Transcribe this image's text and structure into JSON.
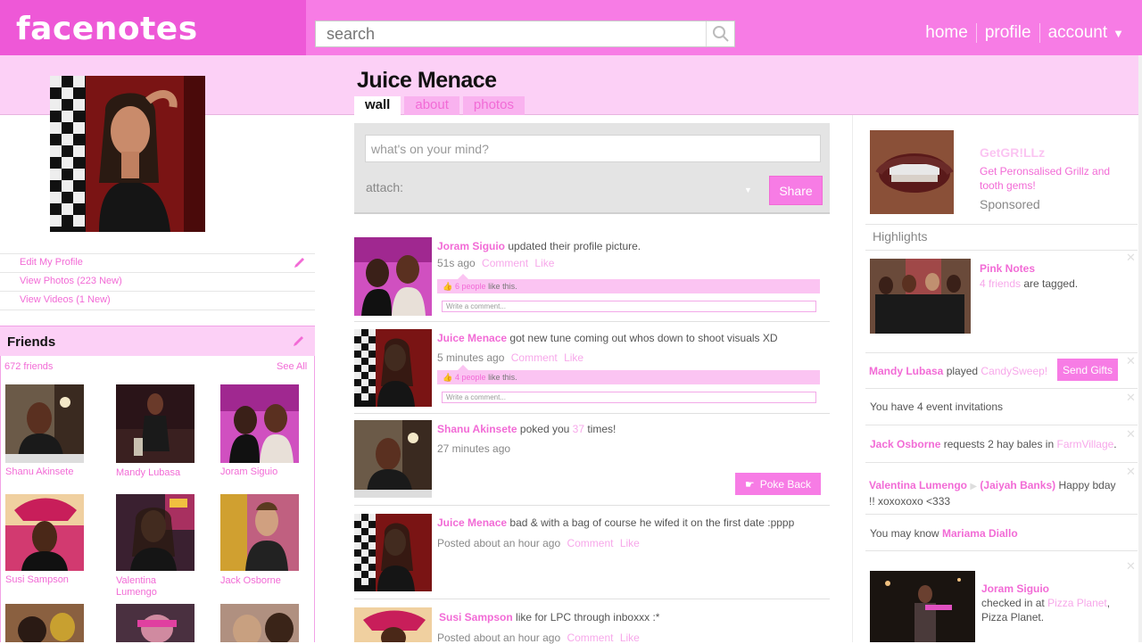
{
  "app": {
    "logo": "facenotes"
  },
  "search": {
    "placeholder": "search"
  },
  "nav": {
    "home": "home",
    "profile": "profile",
    "account": "account"
  },
  "profile": {
    "name": "Juice Menace"
  },
  "tabs": [
    {
      "label": "wall"
    },
    {
      "label": "about"
    },
    {
      "label": "photos"
    }
  ],
  "side_links": [
    "Edit My Profile",
    "View Photos (223 New)",
    "View Videos (1 New)"
  ],
  "friends": {
    "title": "Friends",
    "count": "672 friends",
    "see_all": "See All",
    "list": [
      {
        "name": "Shanu Akinsete"
      },
      {
        "name": "Mandy Lubasa"
      },
      {
        "name": "Joram Siguio"
      },
      {
        "name": "Susi Sampson"
      },
      {
        "name": "Valentina Lumengo"
      },
      {
        "name": "Jack Osborne"
      }
    ]
  },
  "composer": {
    "placeholder": "what's on your mind?",
    "attach": "attach:",
    "share": "Share"
  },
  "posts": [
    {
      "author": "Joram Siguio",
      "text": "updated their profile picture.",
      "time": "51s ago",
      "comment": "Comment",
      "like": "Like",
      "likes_count": "6 people",
      "likes_text": "like this.",
      "comment_placeholder": "Write a comment..."
    },
    {
      "author": "Juice Menace",
      "text": "got new tune coming out whos down to shoot visuals XD",
      "time": "5 minutes ago",
      "comment": "Comment",
      "like": "Like",
      "likes_count": "4 people",
      "likes_text": "like this.",
      "comment_placeholder": "Write a comment..."
    },
    {
      "author": "Shanu Akinsete",
      "text_pre": "poked you",
      "poke_count": "37",
      "text_post": "times!",
      "time": "27 minutes ago",
      "poke_back": "Poke Back"
    },
    {
      "author": "Juice Menace",
      "text": "bad & with a bag of course he wifed it on the first date :pppp",
      "time": "Posted about an hour ago",
      "comment": "Comment",
      "like": "Like"
    },
    {
      "author": "Susi Sampson",
      "text": "like for LPC through inboxxx :*",
      "time": "Posted about an hour ago",
      "comment": "Comment",
      "like": "Like"
    }
  ],
  "ad": {
    "title": "GetGR!LLz",
    "text": "Get Peronsalised Grillz and tooth gems!",
    "sponsored": "Sponsored"
  },
  "highlights": {
    "title": "Highlights",
    "pink_notes": "Pink Notes",
    "tagged_count": "4 friends",
    "tagged_text": "are tagged."
  },
  "feed": {
    "played_name": "Mandy Lubasa",
    "played_text": "played",
    "game": "CandySweep!",
    "send_gifts": "Send Gifts",
    "invitations": "You have 4 event invitations",
    "jack_name": "Jack Osborne",
    "jack_text": "requests 2 hay bales in",
    "farm": "FarmVillage",
    "val_name": "Valentina Lumengo",
    "jaiyah": "(Jaiyah Banks)",
    "bday": "Happy bday !! xoxoxoxo <333",
    "may_know": "You may know",
    "mariama": "Mariama Diallo",
    "checkin_name": "Joram Siguio",
    "checkin_text": "checked in at",
    "place": "Pizza Planet",
    "place_after": "Pizza Planet."
  },
  "colors": {
    "brand": "#ee58d7",
    "accent": "#f77ce5",
    "light": "#fcd0f6",
    "link": "#f26bd6"
  }
}
